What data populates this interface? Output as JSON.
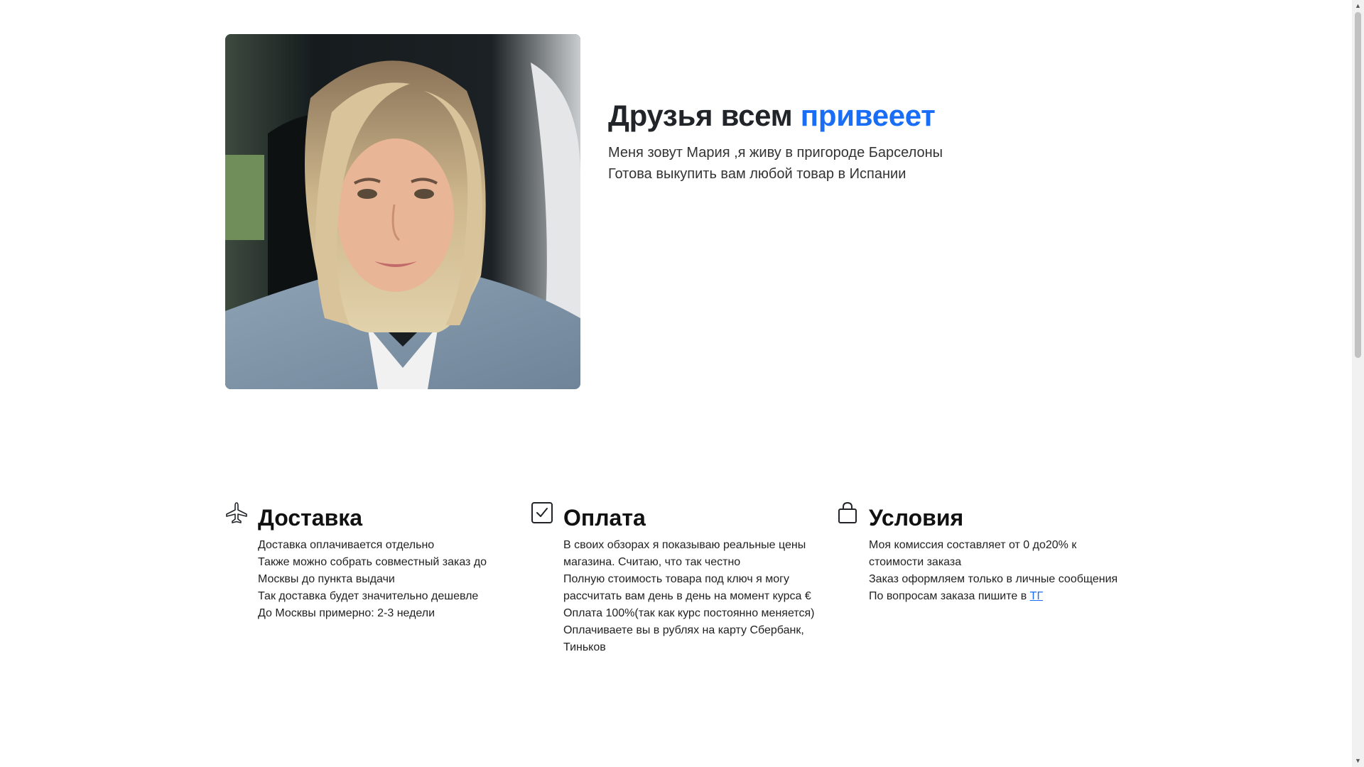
{
  "hero": {
    "title_main": "Друзья всем ",
    "title_accent": "привееет",
    "lines": [
      "Меня зовут Мария ,я живу в пригороде Барселоны",
      "Готова выкупить вам любой товар в Испании"
    ]
  },
  "features": [
    {
      "icon": "airplane-icon",
      "title": "Доставка",
      "lines": [
        "Доставка оплачивается отдельно",
        "Также можно собрать совместный заказ до",
        "Москвы до пункта выдачи",
        "Так доставка будет значительно дешевле",
        "До Москвы примерно: 2-3 недели"
      ]
    },
    {
      "icon": "check-square-icon",
      "title": "Оплата",
      "lines": [
        "В своих обзорах я показываю реальные цены",
        "магазина. Считаю, что так честно",
        "Полную стоимость товара под ключ я могу",
        "рассчитать вам день в день на момент курса €",
        "Оплата 100%(так как курс постоянно меняется)",
        "Оплачиваете вы в рублях на карту Сбербанк,",
        "Тиньков"
      ]
    },
    {
      "icon": "shopping-bag-icon",
      "title": "Условия",
      "lines": [
        "Моя комиссия составляет от 0 до20% к",
        "стоимости заказа",
        "Заказ оформляем только в личные сообщения"
      ],
      "last_line_prefix": "По вопросам заказа пишите в ",
      "link_label": "ТГ"
    }
  ],
  "colors": {
    "accent": "#1a6ef5",
    "text": "#212529"
  }
}
